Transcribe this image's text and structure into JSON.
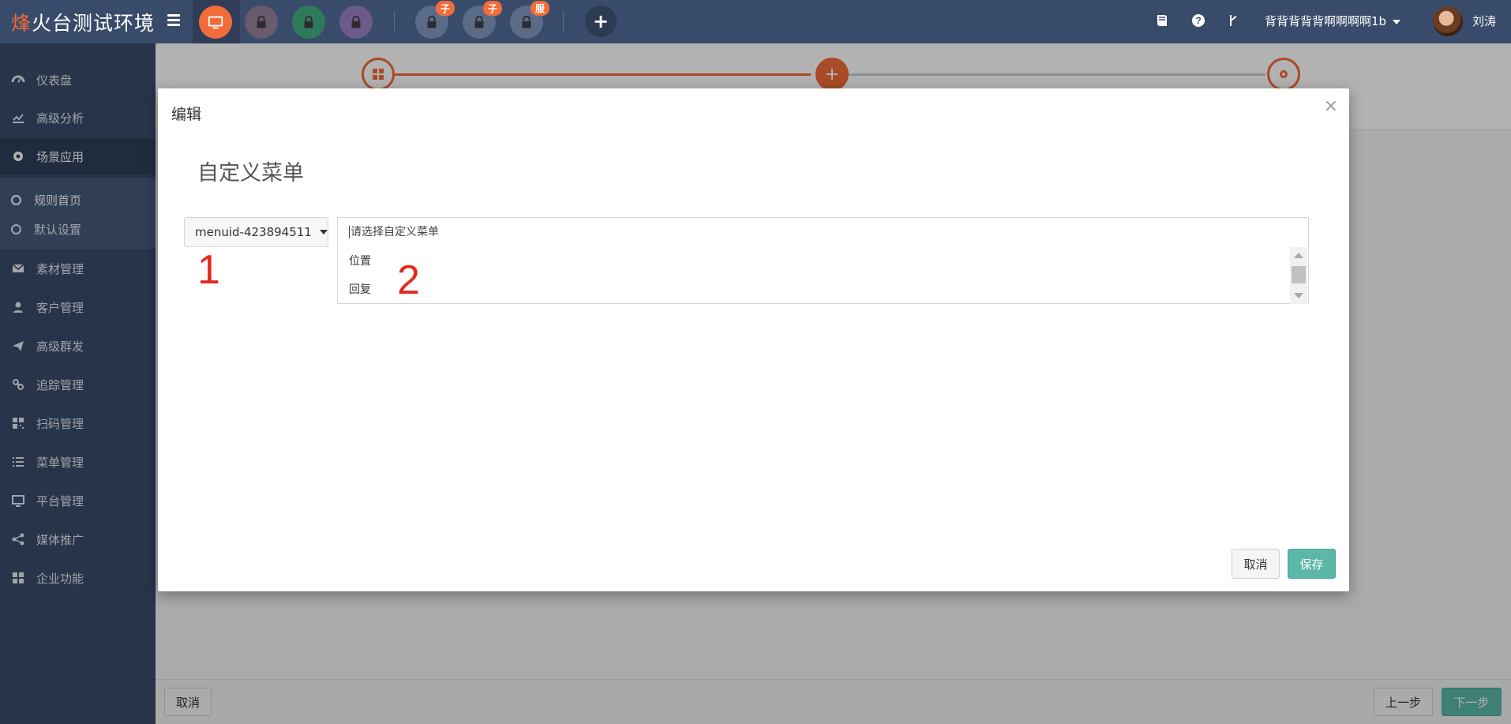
{
  "app": {
    "brand_accent": "烽",
    "brand_rest": "火台测试环境",
    "accent_color": "#f26b3a",
    "nav_bg": "#394b6b"
  },
  "topbar": {
    "badges": [
      "子",
      "子",
      "服"
    ],
    "user_menu": "背背背背背啊啊啊啊1b",
    "username": "刘涛"
  },
  "sidebar": {
    "items": [
      {
        "label": "仪表盘",
        "icon": "dashboard-icon"
      },
      {
        "label": "高级分析",
        "icon": "line-chart-icon"
      },
      {
        "label": "场景应用",
        "icon": "gear-icon"
      },
      {
        "label": "素材管理",
        "icon": "envelope-icon"
      },
      {
        "label": "客户管理",
        "icon": "user-icon"
      },
      {
        "label": "高级群发",
        "icon": "paper-plane-icon"
      },
      {
        "label": "追踪管理",
        "icon": "link-icon"
      },
      {
        "label": "扫码管理",
        "icon": "qrcode-icon"
      },
      {
        "label": "菜单管理",
        "icon": "list-icon"
      },
      {
        "label": "平台管理",
        "icon": "monitor-icon"
      },
      {
        "label": "媒体推广",
        "icon": "share-icon"
      },
      {
        "label": "企业功能",
        "icon": "grid-icon"
      }
    ],
    "subitems": [
      {
        "label": "规则首页"
      },
      {
        "label": "默认设置"
      }
    ]
  },
  "footer": {
    "cancel": "取消",
    "prev": "上一步",
    "next": "下一步"
  },
  "modal": {
    "title": "编辑",
    "close": "×",
    "section_title": "自定义菜单",
    "dropdown_value": "menuid-423894511",
    "select_placeholder": "请选择自定义菜单",
    "options": [
      "位置",
      "回复"
    ],
    "cancel": "取消",
    "save": "保存"
  },
  "annotations": [
    "1",
    "2"
  ]
}
